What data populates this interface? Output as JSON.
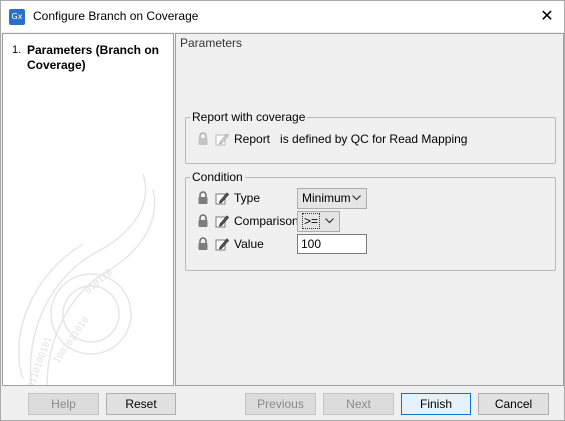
{
  "window": {
    "app_icon_text": "Gx",
    "title": "Configure Branch on Coverage",
    "close_glyph": "✕"
  },
  "steps": [
    {
      "number": "1.",
      "label": "Parameters (Branch on Coverage)"
    }
  ],
  "panel": {
    "title": "Parameters",
    "report_group": {
      "legend": "Report with coverage",
      "field_label": "Report",
      "field_value": "is defined by QC for Read Mapping"
    },
    "condition_group": {
      "legend": "Condition",
      "type": {
        "label": "Type",
        "value": "Minimum"
      },
      "comparison": {
        "label": "Comparison",
        "value": ">="
      },
      "value": {
        "label": "Value",
        "value": "100"
      }
    }
  },
  "buttons": {
    "help": "Help",
    "reset": "Reset",
    "previous": "Previous",
    "next": "Next",
    "finish": "Finish",
    "cancel": "Cancel"
  },
  "icons": {
    "lock": "lock-icon",
    "edit": "edit-pencil-icon",
    "chevron": "chevron-down-icon",
    "watermark": "binary-spiral-watermark"
  },
  "colors": {
    "app_icon": "#2a6fc9",
    "primary_border": "#0078d7"
  }
}
